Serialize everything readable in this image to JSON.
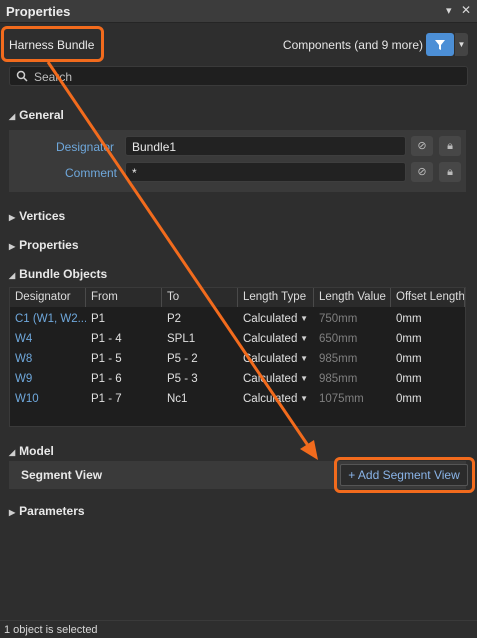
{
  "panel": {
    "title": "Properties",
    "pin_icon": "pin-icon",
    "close_icon": "close-icon"
  },
  "header": {
    "object_type": "Harness Bundle",
    "filter_label": "Components (and 9 more)"
  },
  "search": {
    "placeholder": "Search"
  },
  "general": {
    "section_title": "General",
    "designator_label": "Designator",
    "designator_value": "Bundle1",
    "comment_label": "Comment",
    "comment_value": "*"
  },
  "sections": {
    "vertices": "Vertices",
    "properties": "Properties",
    "bundle_objects": "Bundle Objects",
    "model": "Model",
    "parameters": "Parameters"
  },
  "table": {
    "columns": [
      "Designator",
      "From",
      "To",
      "Length Type",
      "Length Value",
      "Offset Length"
    ],
    "rows": [
      {
        "designator": "C1 (W1, W2...",
        "from": "P1",
        "to": "P2",
        "length_type": "Calculated",
        "length_value": "750mm",
        "offset": "0mm"
      },
      {
        "designator": "W4",
        "from": "P1 - 4",
        "to": "SPL1",
        "length_type": "Calculated",
        "length_value": "650mm",
        "offset": "0mm"
      },
      {
        "designator": "W8",
        "from": "P1 - 5",
        "to": "P5 - 2",
        "length_type": "Calculated",
        "length_value": "985mm",
        "offset": "0mm"
      },
      {
        "designator": "W9",
        "from": "P1 - 6",
        "to": "P5 - 3",
        "length_type": "Calculated",
        "length_value": "985mm",
        "offset": "0mm"
      },
      {
        "designator": "W10",
        "from": "P1 - 7",
        "to": "Nc1",
        "length_type": "Calculated",
        "length_value": "1075mm",
        "offset": "0mm"
      }
    ]
  },
  "model": {
    "segment_view_label": "Segment View",
    "add_button": "+ Add Segment View"
  },
  "status": {
    "text": "1 object is selected"
  },
  "colors": {
    "accent": "#4c8fd6",
    "callout": "#f26b1d",
    "link": "#6fa8dc"
  }
}
